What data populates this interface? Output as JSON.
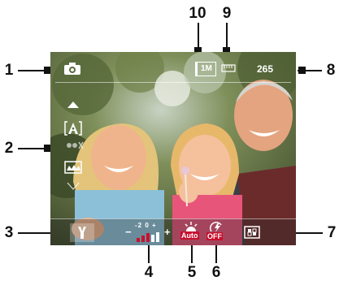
{
  "callouts": {
    "c1": "1",
    "c2": "2",
    "c3": "3",
    "c4": "4",
    "c5": "5",
    "c6": "6",
    "c7": "7",
    "c8": "8",
    "c9": "9",
    "c10": "10"
  },
  "viewfinder": {
    "resolution_label": "1M",
    "remaining_shots": "265",
    "brightness_scale": "-2 0 +",
    "minus_sign": "−",
    "plus_sign": "+",
    "white_balance_label": "Auto",
    "flash_label": "OFF"
  },
  "icons": {
    "capture_mode": "camera-icon",
    "zoom_up": "zoom-up-arrow-icon",
    "zoom_down": "zoom-down-arrow-icon",
    "mode_a": "auto-mode-icon",
    "mode_b": "tint-mode-icon",
    "mode_c": "panorama-mode-icon",
    "settings": "tools-icon",
    "storage": "memory-card-icon",
    "templates": "template-icon"
  },
  "colors": {
    "callout": "#111111",
    "overlay_text": "#ffffff",
    "accent_red": "#c8102e"
  }
}
